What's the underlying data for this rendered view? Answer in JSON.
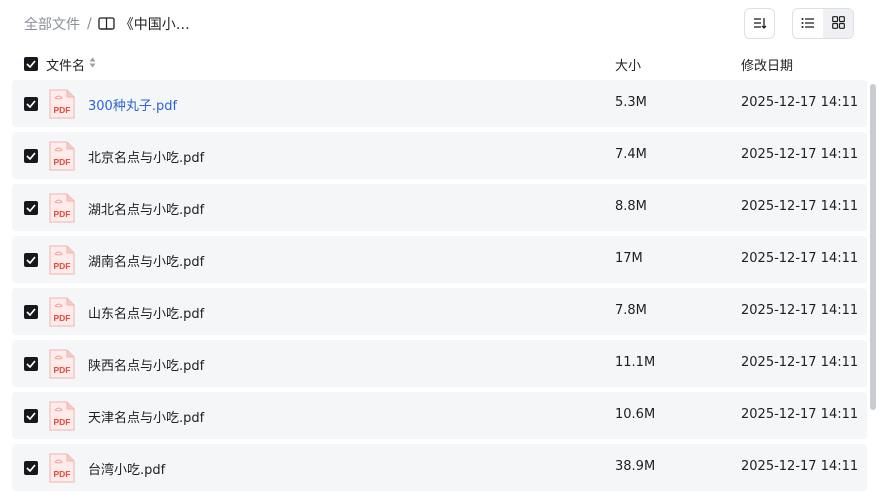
{
  "breadcrumb": {
    "root": "全部文件",
    "separator": "/",
    "current": "《中国小…",
    "icon": "book-icon"
  },
  "toolbar": {
    "sort_icon": "sort-icon",
    "list_view_icon": "list-view-icon",
    "grid_view_icon": "grid-view-icon",
    "active_view": "list"
  },
  "table": {
    "columns": {
      "name": "文件名",
      "size": "大小",
      "modified": "修改日期"
    },
    "all_selected": true,
    "rows": [
      {
        "name": "300种丸子.pdf",
        "size": "5.3M",
        "date": "2025-12-17 14:11",
        "selected": true,
        "highlight": true
      },
      {
        "name": "北京名点与小吃.pdf",
        "size": "7.4M",
        "date": "2025-12-17 14:11",
        "selected": true
      },
      {
        "name": "湖北名点与小吃.pdf",
        "size": "8.8M",
        "date": "2025-12-17 14:11",
        "selected": true
      },
      {
        "name": "湖南名点与小吃.pdf",
        "size": "17M",
        "date": "2025-12-17 14:11",
        "selected": true
      },
      {
        "name": "山东名点与小吃.pdf",
        "size": "7.8M",
        "date": "2025-12-17 14:11",
        "selected": true
      },
      {
        "name": "陕西名点与小吃.pdf",
        "size": "11.1M",
        "date": "2025-12-17 14:11",
        "selected": true
      },
      {
        "name": "天津名点与小吃.pdf",
        "size": "10.6M",
        "date": "2025-12-17 14:11",
        "selected": true
      },
      {
        "name": "台湾小吃.pdf",
        "size": "38.9M",
        "date": "2025-12-17 14:11",
        "selected": true
      }
    ]
  },
  "file_icon": {
    "label": "PDF",
    "color": "#e8463e"
  },
  "colors": {
    "link": "#2c64d6",
    "row_bg": "#f5f6f7",
    "checkbox": "#16181d",
    "muted": "#8a8f99"
  }
}
